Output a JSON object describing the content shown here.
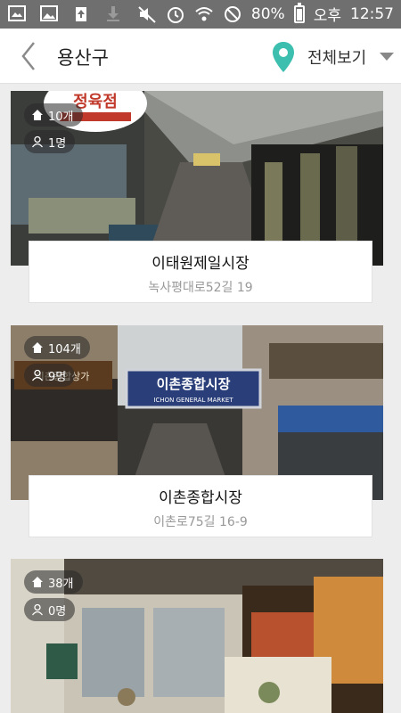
{
  "status_bar": {
    "battery": "80%",
    "ampm": "오후",
    "time": "12:57",
    "icons": [
      "gallery-icon",
      "image-icon",
      "upload-icon",
      "download-icon",
      "mute-icon",
      "alarm-icon",
      "wifi-icon",
      "blocked-icon",
      "battery-icon"
    ]
  },
  "header": {
    "title": "용산구",
    "filter_label": "전체보기",
    "accent_color": "#3dbfb0"
  },
  "markets": [
    {
      "name": "이태원제일시장",
      "address": "녹사평대로52길 19",
      "shops": "10개",
      "visitors": "1명"
    },
    {
      "name": "이촌종합시장",
      "address": "이촌로75길 16-9",
      "shops": "104개",
      "visitors": "9명"
    },
    {
      "name": "",
      "address": "",
      "shops": "38개",
      "visitors": "0명"
    }
  ],
  "photo_signs": {
    "m1_sign": "정육점",
    "m2_sign_ko": "이촌종합시장",
    "m2_sign_en": "ICHON GENERAL MARKET",
    "m2_side_sign": "이촌종합상가"
  }
}
